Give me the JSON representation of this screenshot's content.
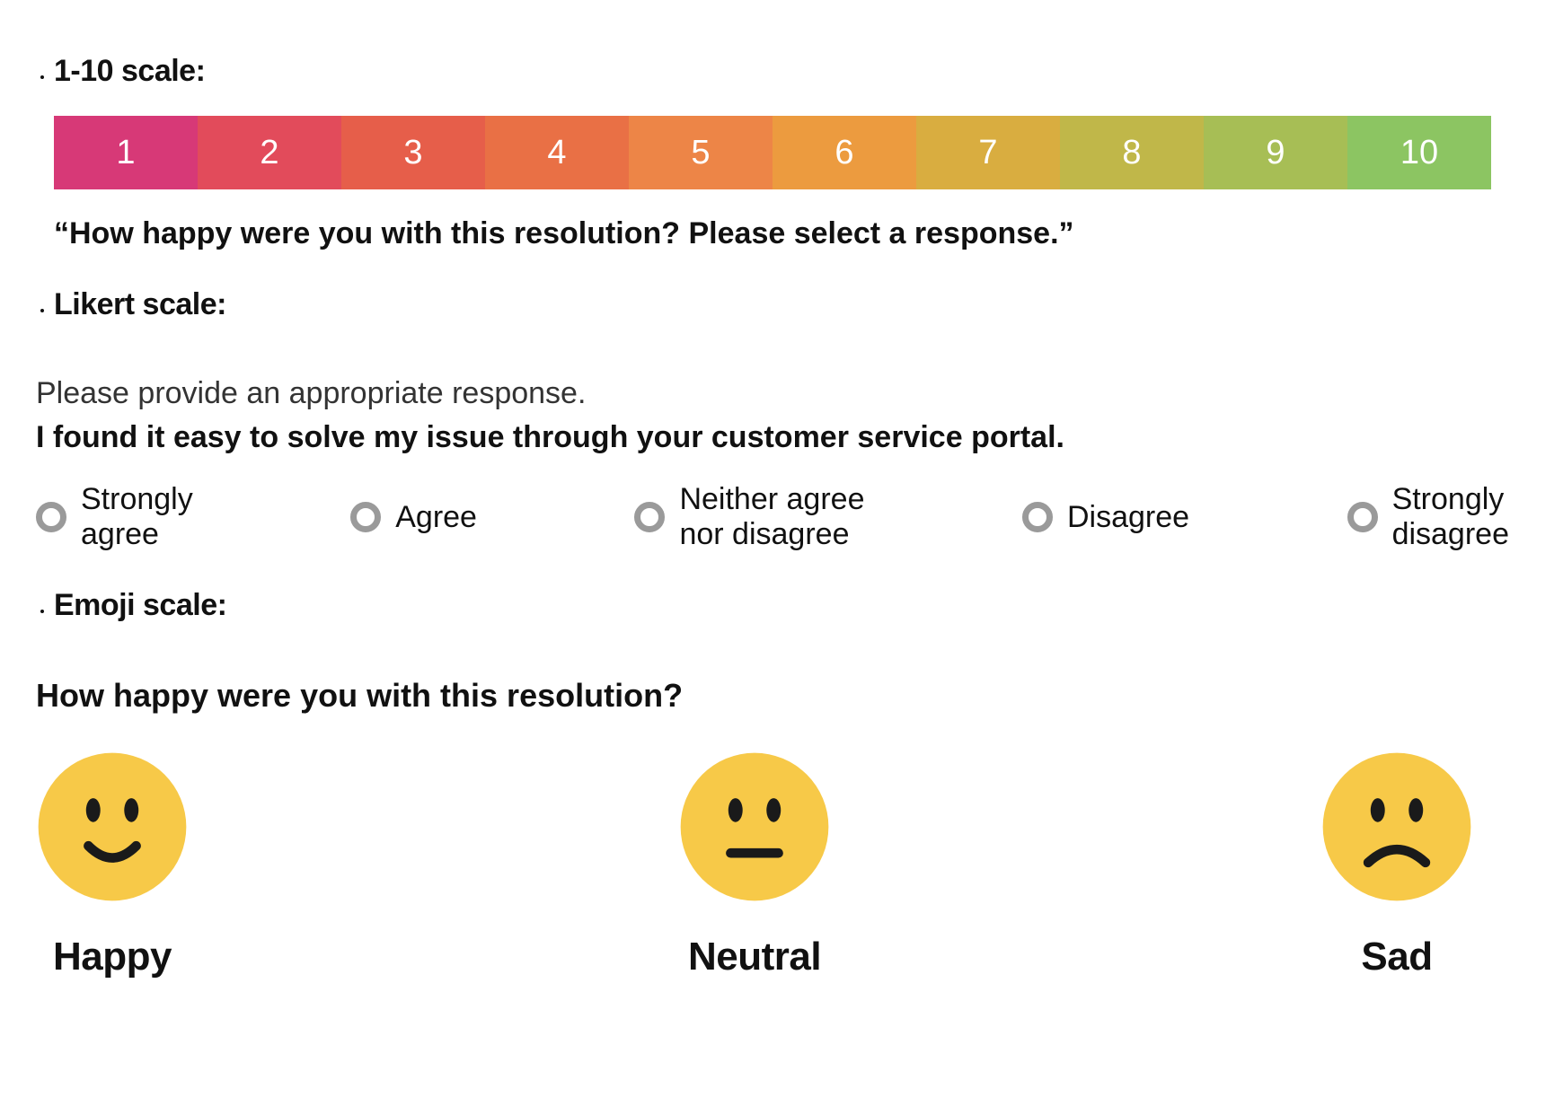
{
  "sections": {
    "scale10": {
      "label": "1-10 scale:",
      "values": [
        "1",
        "2",
        "3",
        "4",
        "5",
        "6",
        "7",
        "8",
        "9",
        "10"
      ],
      "colors": [
        "#D73977",
        "#E24B5B",
        "#E65E4A",
        "#E97045",
        "#ED8547",
        "#EC9B3F",
        "#D9AD40",
        "#C0B749",
        "#A7BE55",
        "#8CC562"
      ],
      "prompt": "“How happy were you with this resolution? Please select a response.”"
    },
    "likert": {
      "label": "Likert scale:",
      "lead": "Please provide an appropriate response.",
      "statement": "I found it easy to solve my issue through your customer service portal.",
      "options": [
        "Strongly agree",
        "Agree",
        "Neither agree nor disagree",
        "Disagree",
        "Strongly disagree"
      ]
    },
    "emoji": {
      "label": "Emoji scale:",
      "question": "How happy were you with this resolution?",
      "options": [
        {
          "name": "Happy",
          "face": "happy"
        },
        {
          "name": "Neutral",
          "face": "neutral"
        },
        {
          "name": "Sad",
          "face": "sad"
        }
      ],
      "face_color": "#F7C948"
    }
  }
}
